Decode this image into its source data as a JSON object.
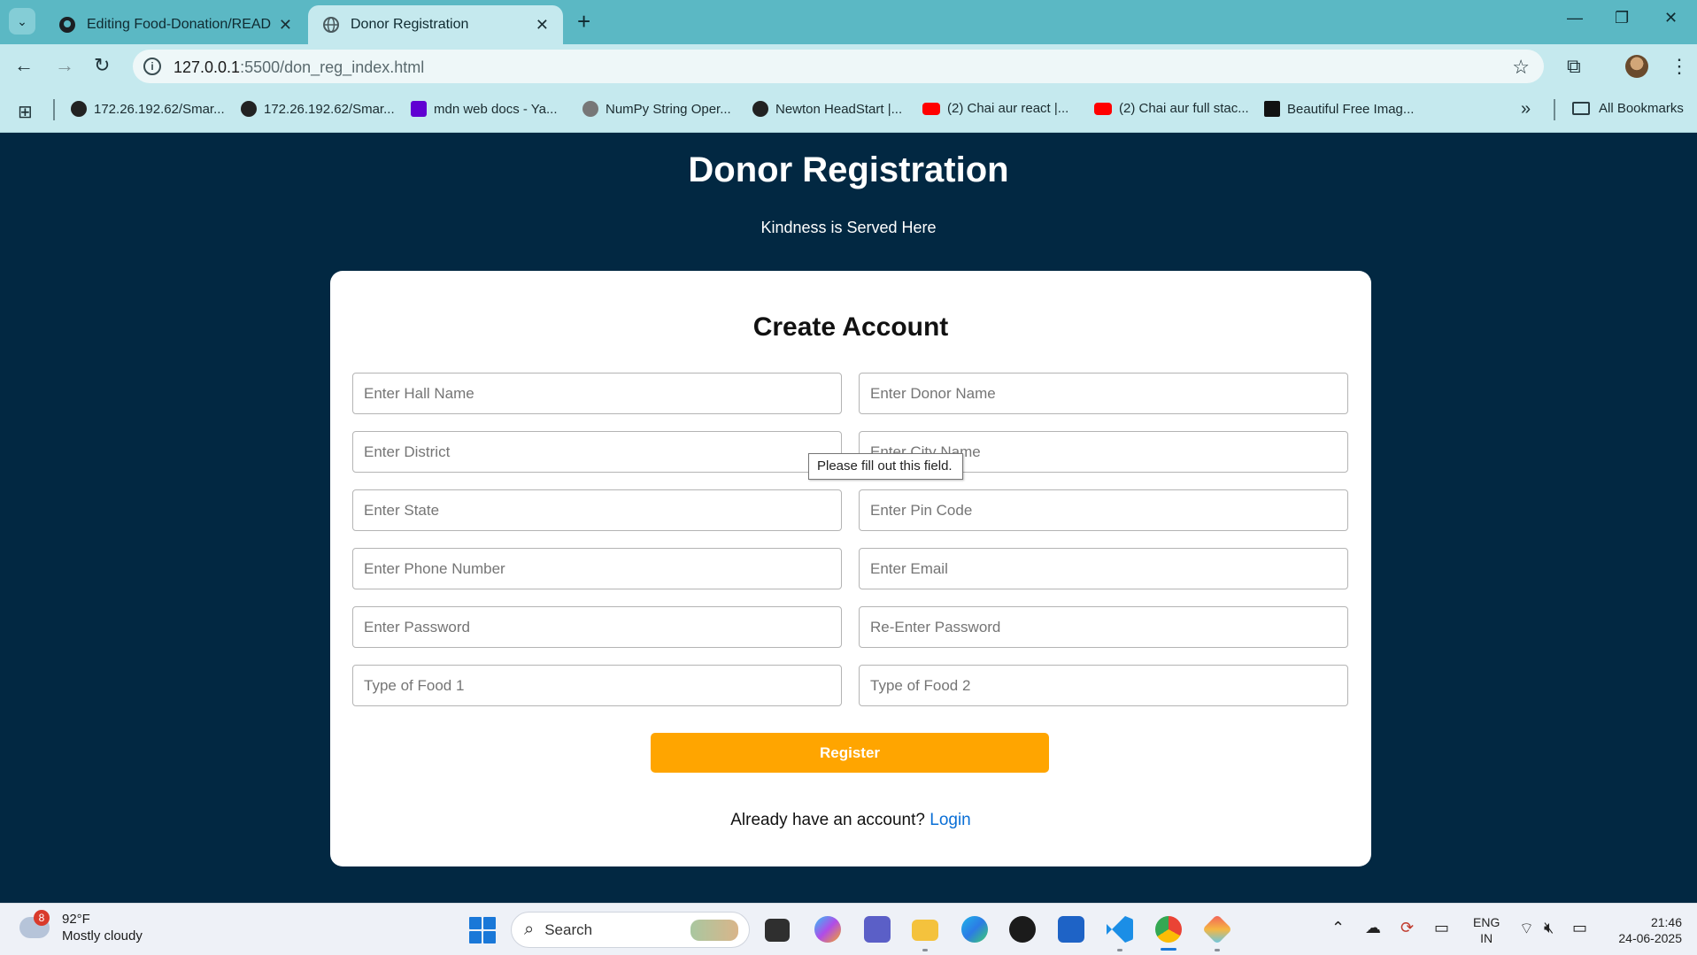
{
  "browser": {
    "tabs": [
      {
        "title": "Editing Food-Donation/READM",
        "icon": "github-icon"
      },
      {
        "title": "Donor Registration",
        "icon": "globe-icon"
      }
    ],
    "new_tab": "+",
    "address": {
      "host": "127.0.0.1",
      "path": ":5500/don_reg_index.html"
    },
    "bookmarks": [
      {
        "label": "172.26.192.62/Smar...",
        "icon": "globe-icon"
      },
      {
        "label": "172.26.192.62/Smar...",
        "icon": "globe-icon"
      },
      {
        "label": "mdn web docs - Ya...",
        "icon": "yahoo-icon"
      },
      {
        "label": "NumPy String Oper...",
        "icon": "numpy-icon"
      },
      {
        "label": "Newton HeadStart |...",
        "icon": "globe-icon"
      },
      {
        "label": "(2) Chai aur react |...",
        "icon": "youtube-icon"
      },
      {
        "label": "(2) Chai aur full stac...",
        "icon": "youtube-icon"
      },
      {
        "label": "Beautiful Free Imag...",
        "icon": "unsplash-icon"
      }
    ],
    "all_bookmarks": "All Bookmarks"
  },
  "page": {
    "title": "Donor Registration",
    "subtitle": "Kindness is Served Here",
    "card_title": "Create Account",
    "fields": {
      "hall": "Enter Hall Name",
      "donor": "Enter Donor Name",
      "district": "Enter District",
      "city": "Enter City Name",
      "state": "Enter State",
      "pin": "Enter Pin Code",
      "phone": "Enter Phone Number",
      "email": "Enter Email",
      "password": "Enter Password",
      "repassword": "Re-Enter Password",
      "food1": "Type of Food 1",
      "food2": "Type of Food 2"
    },
    "register_label": "Register",
    "login_prompt": "Already have an account?",
    "login_link": "Login",
    "tooltip": "Please fill out this field.",
    "accent_color": "#ffa500",
    "background_color": "#022842"
  },
  "taskbar": {
    "weather_badge": "8",
    "temperature": "92°F",
    "condition": "Mostly cloudy",
    "search_label": "Search",
    "lang_top": "ENG",
    "lang_bottom": "IN",
    "time": "21:46",
    "date": "24-06-2025"
  }
}
